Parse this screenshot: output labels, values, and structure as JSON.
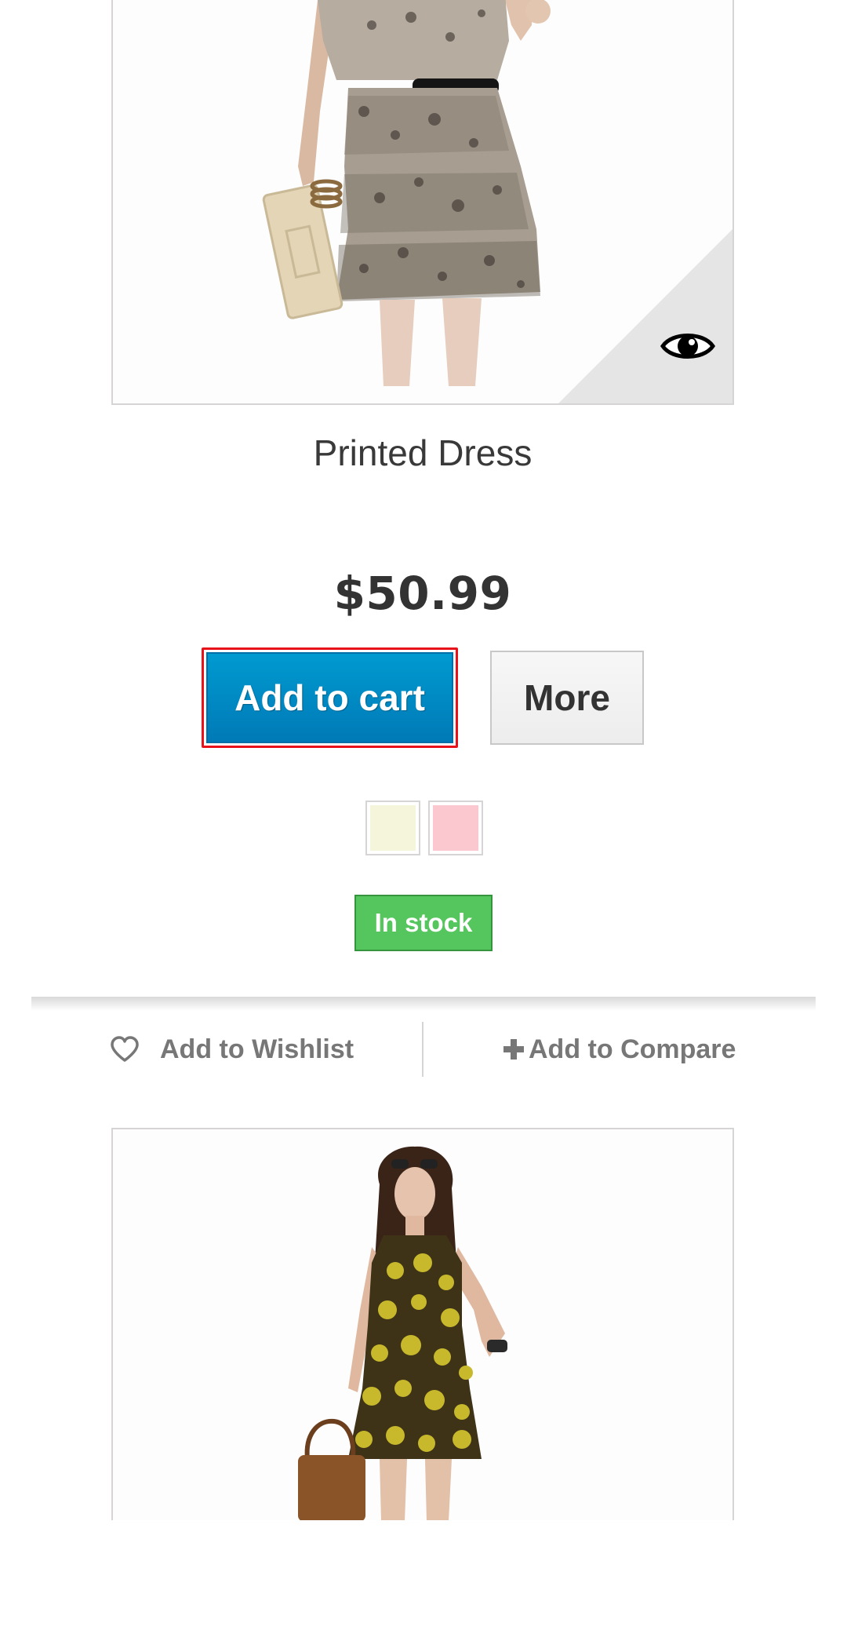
{
  "product_1": {
    "name": "Printed Dress",
    "price": "$50.99",
    "add_to_cart_label": "Add to cart",
    "more_label": "More",
    "stock_label": "In stock",
    "quick_view_icon": "eye-icon",
    "color_swatches": [
      {
        "name": "beige",
        "color": "#f5f5dc"
      },
      {
        "name": "pink",
        "color": "#fcc8cf"
      }
    ]
  },
  "functional_bar": {
    "wishlist_label": "Add to Wishlist",
    "wishlist_icon": "heart-icon",
    "compare_label": "Add to Compare",
    "compare_icon": "plus-icon"
  },
  "product_2": {
    "image": "yellow-floral-dress-image"
  },
  "colors": {
    "accent_blue": "#0089c9",
    "stock_green": "#55c65e",
    "focus_red": "#e8121a",
    "text_dark": "#333333",
    "text_muted": "#777777"
  }
}
